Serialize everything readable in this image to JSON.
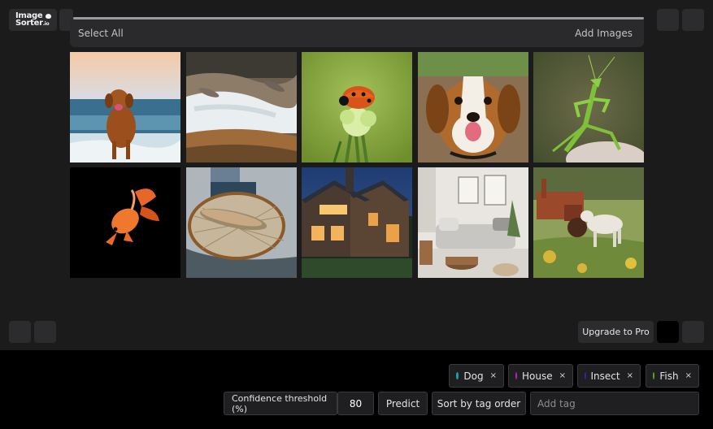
{
  "header": {
    "logo_line1": "Image",
    "logo_line2": "Sorter",
    "logo_suffix": ".io",
    "progress_fraction": 1.0
  },
  "toolbar": {
    "select_all": "Select All",
    "add_images": "Add Images"
  },
  "images": [
    {
      "subject": "dog"
    },
    {
      "subject": "fish"
    },
    {
      "subject": "insect"
    },
    {
      "subject": "dog"
    },
    {
      "subject": "insect"
    },
    {
      "subject": "fish"
    },
    {
      "subject": "fish"
    },
    {
      "subject": "house"
    },
    {
      "subject": "house"
    },
    {
      "subject": "dog"
    }
  ],
  "footer": {
    "upgrade_label": "Upgrade to Pro"
  },
  "tags": [
    {
      "label": "Dog",
      "color": "#19a3a3",
      "remove": "×"
    },
    {
      "label": "House",
      "color": "#c41ec4",
      "remove": "×"
    },
    {
      "label": "Insect",
      "color": "#2a2aa8",
      "remove": "×"
    },
    {
      "label": "Fish",
      "color": "#5aa02a",
      "remove": "×"
    }
  ],
  "controls": {
    "confidence_label": "Confidence threshold (%)",
    "confidence_value": "80",
    "predict_label": "Predict",
    "sort_label": "Sort by tag order",
    "add_tag_placeholder": "Add tag"
  },
  "colors": {
    "background": "#1b1b1c",
    "panel": "#2c2c2e",
    "bottom_panel": "#000000"
  }
}
